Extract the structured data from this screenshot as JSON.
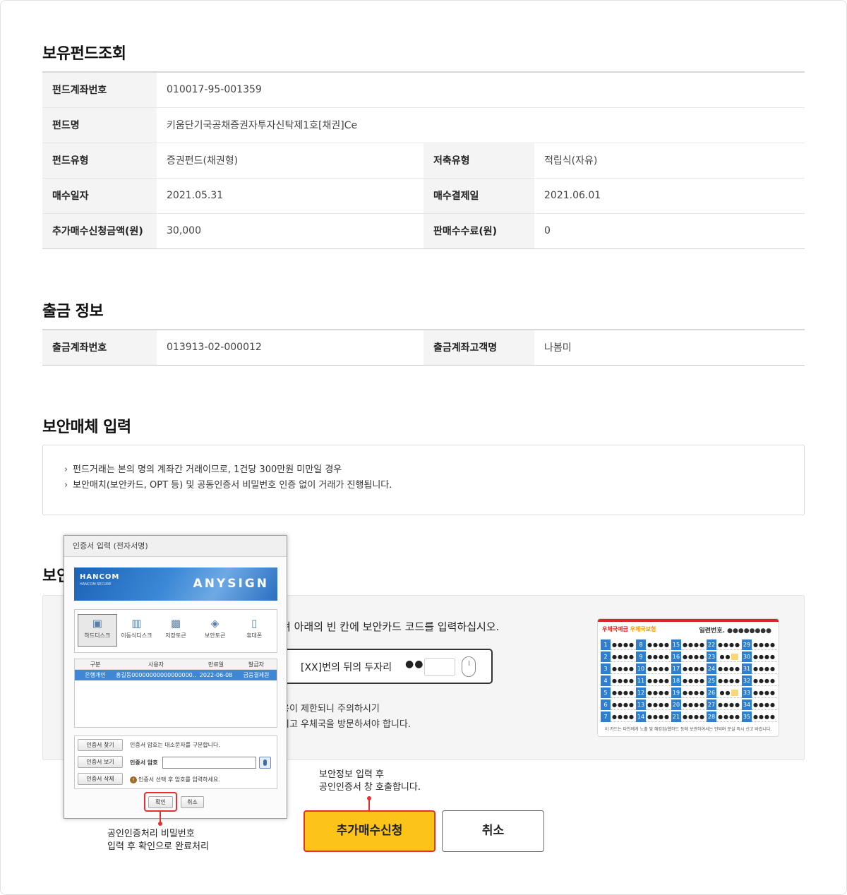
{
  "holding": {
    "title": "보유펀드조회",
    "fund_account_label": "펀드계좌번호",
    "fund_account": "010017-95-001359",
    "fund_name_label": "펀드명",
    "fund_name": "키움단기국공채증권자투자신탁제1호[채권]Ce",
    "fund_type_label": "펀드유형",
    "fund_type": "증권펀드(채권형)",
    "saving_type_label": "저축유형",
    "saving_type": "적립식(자유)",
    "buy_date_label": "매수일자",
    "buy_date": "2021.05.31",
    "settle_date_label": "매수결제일",
    "settle_date": "2021.06.01",
    "add_amount_label": "추가매수신청금액(원)",
    "add_amount": "30,000",
    "fee_label": "판매수수료(원)",
    "fee": "0"
  },
  "withdraw": {
    "title": "출금 정보",
    "account_label": "출금계좌번호",
    "account": "013913-02-000012",
    "owner_label": "출금계좌고객명",
    "owner": "나봄미"
  },
  "security": {
    "title": "보안매체 입력",
    "notices": [
      "펀드거래는 본의 명의 계좌간 거래이므로, 1건당 300만원 미만일 경우",
      "보안매치(보안카드, OPT 등) 및 공동인증서 비밀번호 인증 없이 거래가 진행됩니다."
    ],
    "title_partial": "보안",
    "instruction": "려 아래의 빈 칸에 보안카드 코드를 입력하십시오.",
    "code_label": "[XX]번의 뒤의 두자리",
    "code_dots": "●●",
    "warn1": "용이 제한되니 주의하시기",
    "warn2": "시고 우체국을 방문하셔야 합니다."
  },
  "sec_card": {
    "logo_a": "우체국예금",
    "logo_b": "우체국보험",
    "serial_label": "일련번호. ●●●●●●●●",
    "numbers": [
      [
        1,
        8,
        15,
        22,
        29
      ],
      [
        2,
        9,
        16,
        23,
        30
      ],
      [
        3,
        10,
        17,
        24,
        31
      ],
      [
        4,
        11,
        18,
        25,
        32
      ],
      [
        5,
        12,
        19,
        26,
        33
      ],
      [
        6,
        13,
        20,
        27,
        34
      ],
      [
        7,
        14,
        21,
        28,
        35
      ]
    ],
    "dots": "●●●●",
    "footer": "이 카드는 타인에게 노출 및 해킹된/웹하드 등에 보관하여서는 안되며 분실 즉시 신고 바랍니다."
  },
  "dialog": {
    "title": "인증서 입력 (전자서명)",
    "brand": "HANCOM",
    "brand_sub": "HANCOM SECURE",
    "product": "ANYSIGN",
    "drives": [
      {
        "label": "하드디스크",
        "icon": "monitor-icon"
      },
      {
        "label": "이동식디스크",
        "icon": "usb-icon"
      },
      {
        "label": "저장토큰",
        "icon": "token-icon"
      },
      {
        "label": "보안토큰",
        "icon": "lock-token-icon"
      },
      {
        "label": "휴대폰",
        "icon": "phone-icon"
      }
    ],
    "cols": [
      "구분",
      "사용자",
      "만료일",
      "발급자"
    ],
    "cert": {
      "type": "은행개인",
      "user": "홍길동00000000000000000..",
      "expire": "2022-06-08",
      "issuer": "금융결제원"
    },
    "find_btn": "인증서 찾기",
    "view_btn": "인증서 보기",
    "delete_btn": "인증서 삭제",
    "case_note": "인증서 암호는 대소문자를 구분합니다.",
    "pw_label": "인증서 암호",
    "pw_hint": "인증서 선택 후 암호를 입력하세요.",
    "ok": "확인",
    "cancel": "취소"
  },
  "callouts": {
    "left_line1": "공인인증처리 비밀번호",
    "left_line2": "입력 후 확인으로 완료처리",
    "right_line1": "보안정보 입력 후",
    "right_line2": "공인인증서 창 호출합니다."
  },
  "actions": {
    "apply": "추가매수신청",
    "cancel": "취소"
  },
  "colors": {
    "accent": "#fcc419",
    "highlight": "#e53030",
    "cert_blue": "#3f86d4"
  }
}
